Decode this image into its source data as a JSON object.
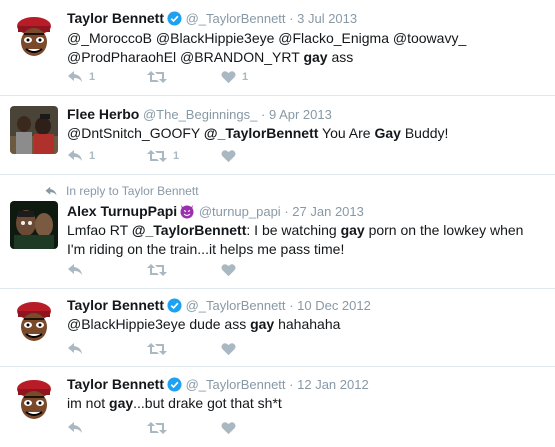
{
  "colors": {
    "muted": "#8899a6",
    "icon": "#aab8c2",
    "verified": "#1da1f2",
    "border": "#e1e8ed"
  },
  "tweets": [
    {
      "name": "Taylor Bennett",
      "verified": true,
      "handle": "@_TaylorBennett",
      "dot": "·",
      "time": "3 Jul 2013",
      "reply_context": null,
      "text_parts": [
        {
          "t": "@_MoroccoB @BlackHippie3eye @Flacko_Enigma @toowavy_ @ProdPharaohEl @BRANDON_YRT "
        },
        {
          "t": "gay",
          "bold": true
        },
        {
          "t": " ass"
        }
      ],
      "counts": {
        "reply": "1",
        "retweet": "",
        "like": "1"
      }
    },
    {
      "name": "Flee Herbo",
      "verified": false,
      "handle": "@The_Beginnings_",
      "dot": "·",
      "time": "9 Apr 2013",
      "reply_context": null,
      "text_parts": [
        {
          "t": "@DntSnitch_GOOFY "
        },
        {
          "t": "@_TaylorBennett",
          "bold": true
        },
        {
          "t": "  You Are "
        },
        {
          "t": "Gay",
          "bold": true
        },
        {
          "t": " Buddy!"
        }
      ],
      "counts": {
        "reply": "1",
        "retweet": "1",
        "like": ""
      }
    },
    {
      "name": "Alex TurnupPapi",
      "emoji": "devil",
      "verified": false,
      "handle": "@turnup_papi",
      "dot": "·",
      "time": "27 Jan 2013",
      "reply_context": "In reply to Taylor Bennett",
      "text_parts": [
        {
          "t": "Lmfao RT "
        },
        {
          "t": "@_TaylorBennett",
          "bold": true
        },
        {
          "t": ": I be watching "
        },
        {
          "t": "gay",
          "bold": true
        },
        {
          "t": " porn on the lowkey when I'm riding on the train...it helps me pass time!"
        }
      ],
      "counts": {
        "reply": "",
        "retweet": "",
        "like": ""
      }
    },
    {
      "name": "Taylor Bennett",
      "verified": true,
      "handle": "@_TaylorBennett",
      "dot": "·",
      "time": "10 Dec 2012",
      "reply_context": null,
      "text_parts": [
        {
          "t": "@BlackHippie3eye dude ass "
        },
        {
          "t": "gay",
          "bold": true
        },
        {
          "t": " hahahaha"
        }
      ],
      "counts": {
        "reply": "",
        "retweet": "",
        "like": ""
      }
    },
    {
      "name": "Taylor Bennett",
      "verified": true,
      "handle": "@_TaylorBennett",
      "dot": "·",
      "time": "12 Jan 2012",
      "reply_context": null,
      "text_parts": [
        {
          "t": "im not "
        },
        {
          "t": "gay",
          "bold": true
        },
        {
          "t": "...but drake got that sh*t"
        }
      ],
      "counts": {
        "reply": "",
        "retweet": "",
        "like": ""
      }
    }
  ]
}
